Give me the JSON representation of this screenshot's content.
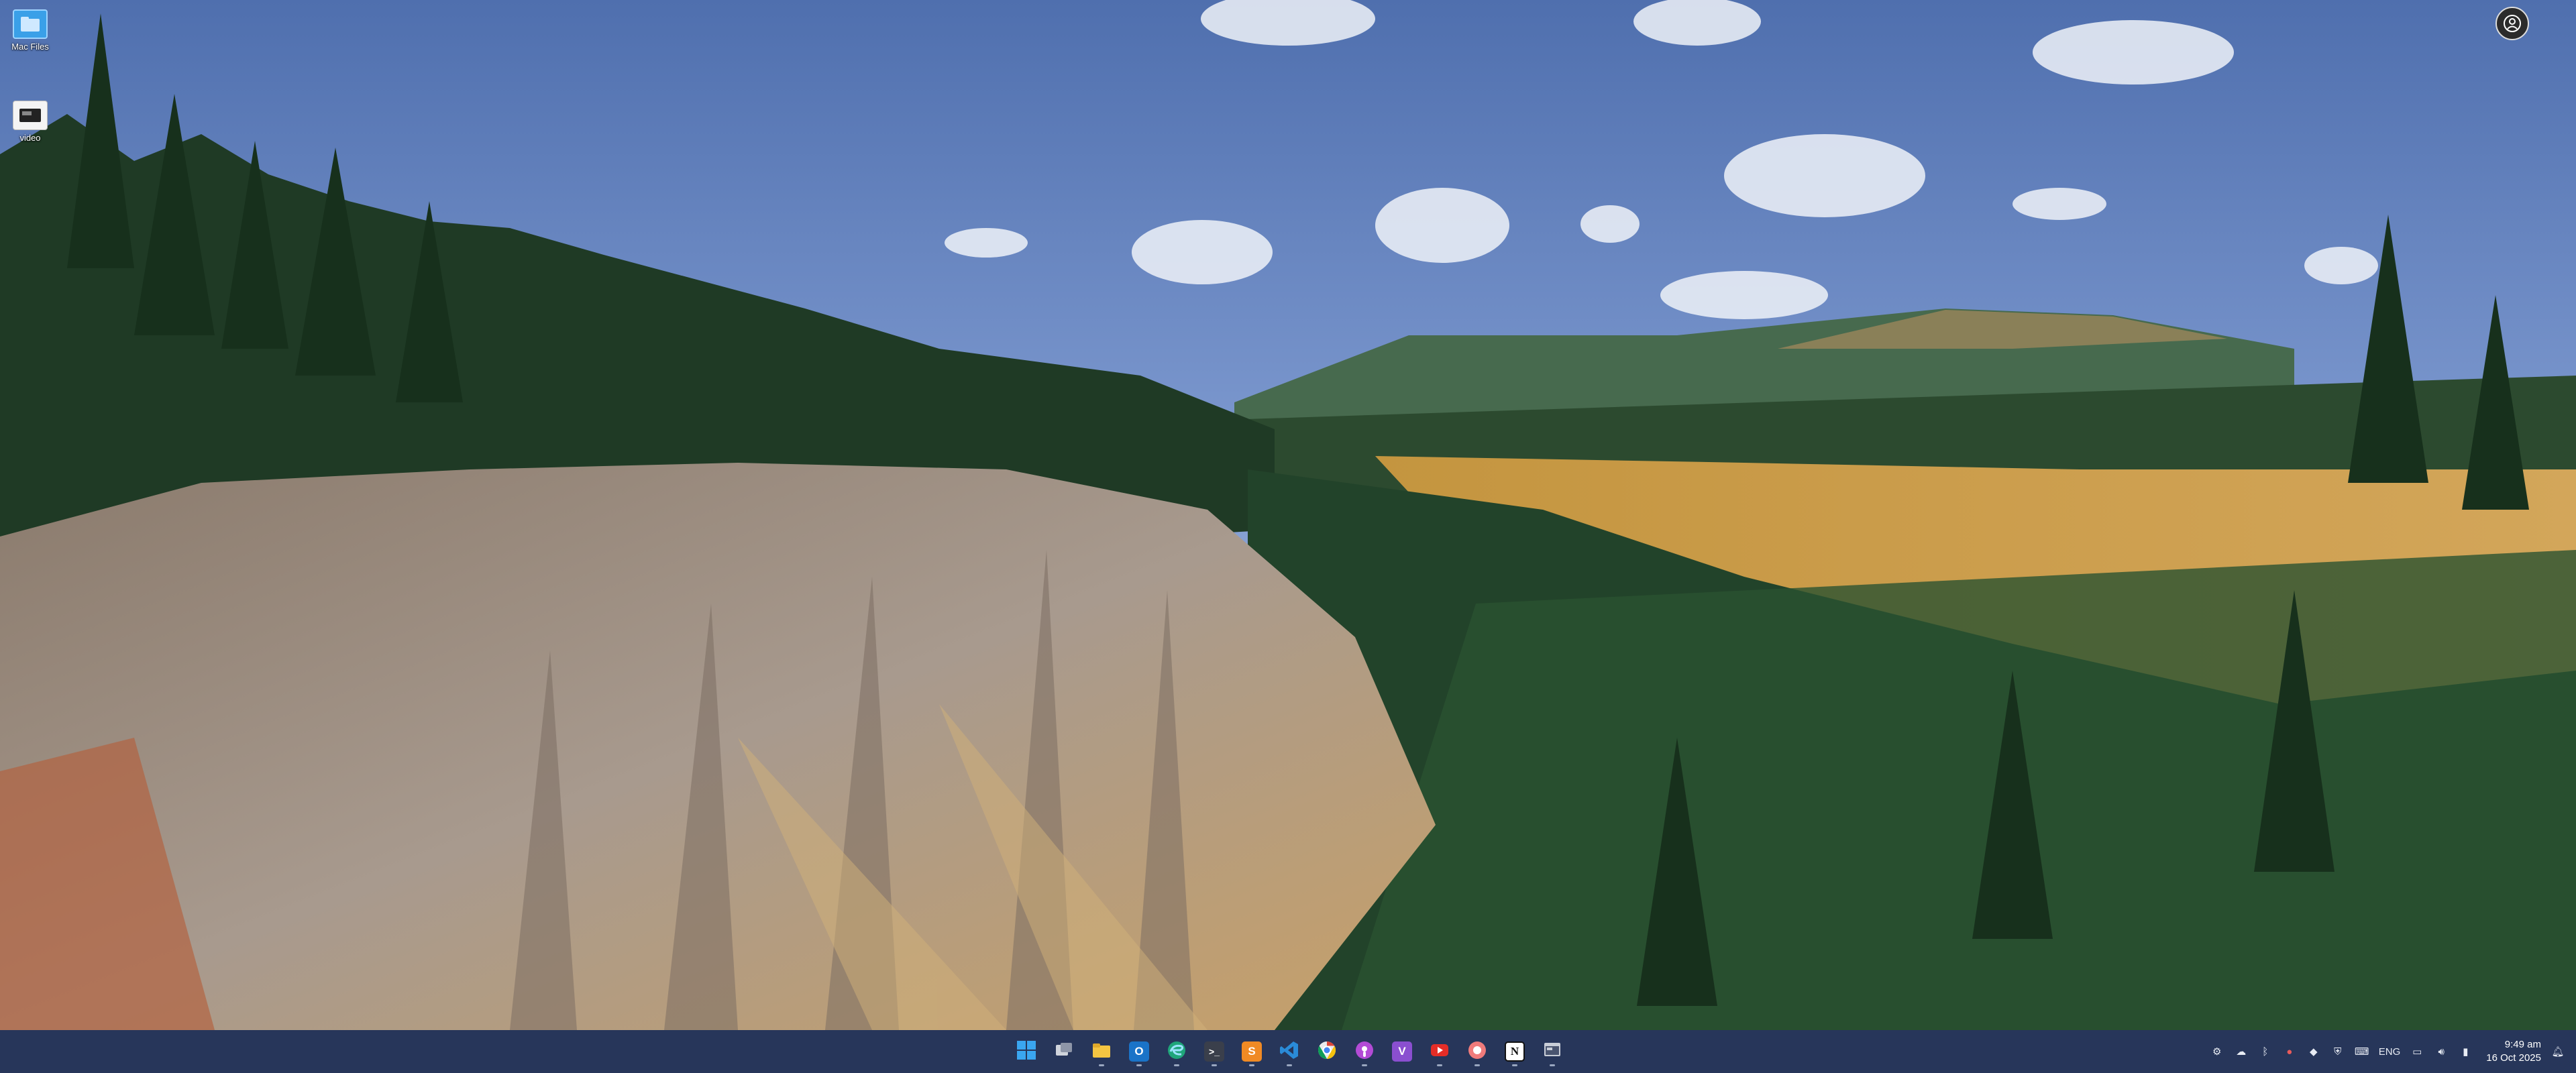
{
  "desktop": {
    "icons": [
      {
        "label": "Mac Files",
        "icon": "folder-icon"
      },
      {
        "label": "video",
        "icon": "video-file-icon"
      }
    ],
    "profile_label": "",
    "profile_icon": "user-profile-icon"
  },
  "taskbar": {
    "apps": [
      {
        "name": "start",
        "icon": "windows-start-icon",
        "color": "#2f9be8"
      },
      {
        "name": "task-view",
        "icon": "task-view-icon",
        "color": "#d0d4dc"
      },
      {
        "name": "file-explorer",
        "icon": "folder-icon",
        "color": "#f4c542"
      },
      {
        "name": "outlook",
        "icon": "outlook-icon",
        "color": "#1a73c8"
      },
      {
        "name": "edge",
        "icon": "edge-icon",
        "color": "#1fa67a"
      },
      {
        "name": "terminal",
        "icon": "terminal-icon",
        "color": "#3a3f4b"
      },
      {
        "name": "sublime",
        "icon": "sublime-icon",
        "color": "#f08a24"
      },
      {
        "name": "vscode",
        "icon": "vscode-icon",
        "color": "#2a8bd8"
      },
      {
        "name": "chrome",
        "icon": "chrome-icon",
        "color": "#e8eaed"
      },
      {
        "name": "podcasts",
        "icon": "podcast-icon",
        "color": "#b34bd6"
      },
      {
        "name": "visual-studio",
        "icon": "visual-studio-icon",
        "color": "#8a4fd0"
      },
      {
        "name": "youtube",
        "icon": "youtube-icon",
        "color": "#e52d27"
      },
      {
        "name": "app-red",
        "icon": "circle-app-icon",
        "color": "#f07b7b"
      },
      {
        "name": "notion",
        "icon": "notion-icon",
        "color": "#ffffff"
      },
      {
        "name": "app-window",
        "icon": "window-app-icon",
        "color": "#c9ced8"
      }
    ],
    "tray": {
      "lang": "ENG",
      "time": "9:49 am",
      "date": "16 Oct 2025"
    }
  }
}
